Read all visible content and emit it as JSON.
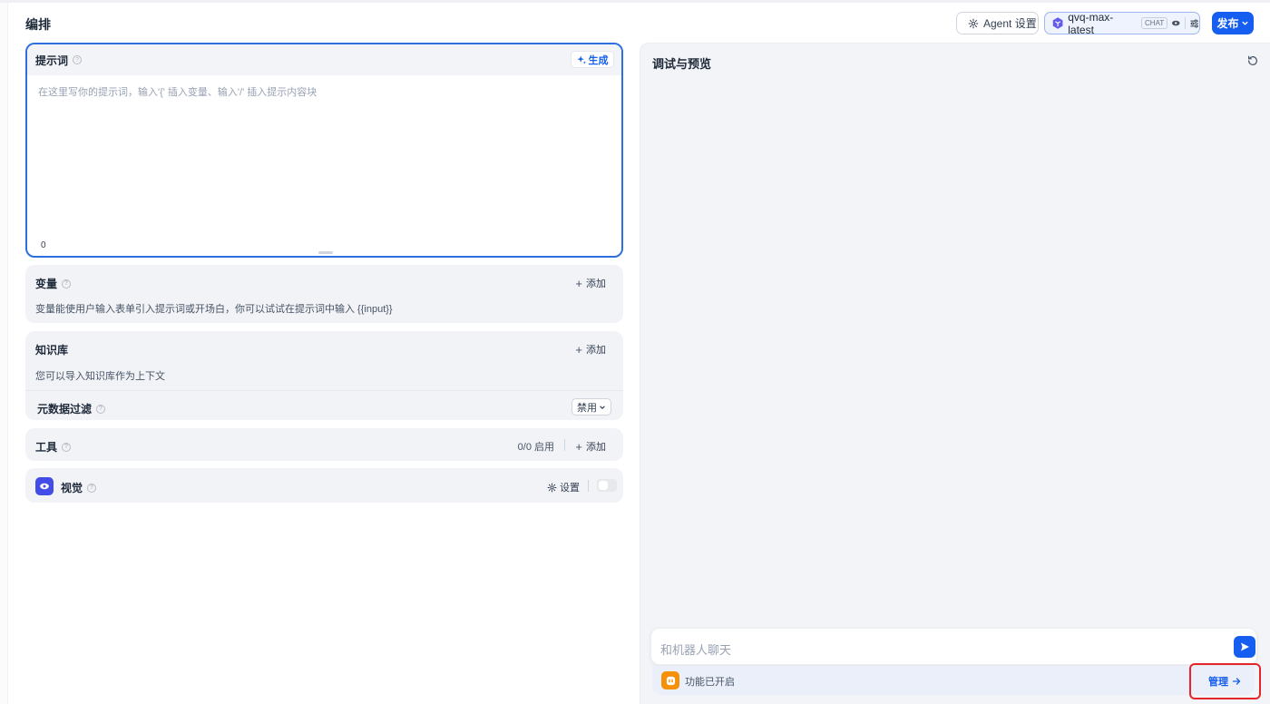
{
  "header": {
    "title": "编排",
    "agent_settings_label": "Agent 设置",
    "model_name": "qvq-max-latest",
    "model_badge": "CHAT",
    "publish_label": "发布"
  },
  "prompt": {
    "title": "提示词",
    "generate_label": "生成",
    "placeholder": "在这里写你的提示词，输入'{' 插入变量、输入'/' 插入提示内容块",
    "char_count": "0"
  },
  "variables": {
    "title": "变量",
    "add_label": "添加",
    "description": "变量能使用户输入表单引入提示词或开场白，你可以试试在提示词中输入 {{input}}"
  },
  "knowledge": {
    "title": "知识库",
    "add_label": "添加",
    "description": "您可以导入知识库作为上下文",
    "metadata_filter_label": "元数据过滤",
    "metadata_filter_value": "禁用"
  },
  "tools": {
    "title": "工具",
    "count": "0/0 启用",
    "add_label": "添加"
  },
  "vision": {
    "title": "视觉",
    "settings_label": "设置",
    "enabled": false
  },
  "preview": {
    "title": "调试与预览",
    "chat_placeholder": "和机器人聊天",
    "feature_status": "功能已开启",
    "manage_label": "管理"
  },
  "colors": {
    "accent": "#155eef",
    "highlight": "#e5252a",
    "feature_icon": "#f79009",
    "vision_icon": "#444ce7"
  }
}
